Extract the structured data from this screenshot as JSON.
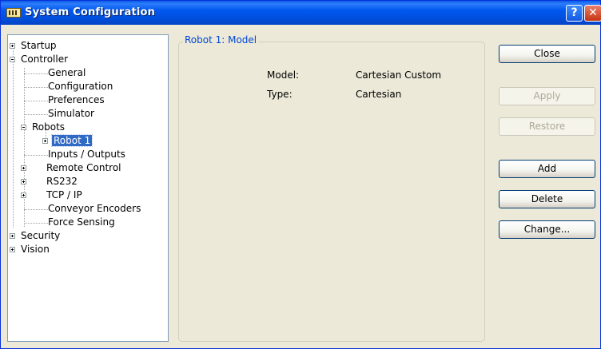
{
  "window": {
    "title": "System Configuration",
    "help_glyph": "?",
    "close_glyph": "✕"
  },
  "tree": {
    "items": [
      {
        "label": "Startup",
        "expander": "plus"
      },
      {
        "label": "Controller",
        "expander": "minus"
      },
      {
        "label": "General"
      },
      {
        "label": "Configuration"
      },
      {
        "label": "Preferences"
      },
      {
        "label": "Simulator"
      },
      {
        "label": "Robots",
        "expander": "minus"
      },
      {
        "label": "Robot 1",
        "expander": "plus",
        "selected": true
      },
      {
        "label": "Inputs / Outputs"
      },
      {
        "label": "Remote Control",
        "expander": "plus"
      },
      {
        "label": "RS232",
        "expander": "plus"
      },
      {
        "label": "TCP / IP",
        "expander": "plus"
      },
      {
        "label": "Conveyor Encoders"
      },
      {
        "label": "Force Sensing"
      },
      {
        "label": "Security",
        "expander": "plus"
      },
      {
        "label": "Vision",
        "expander": "plus"
      }
    ]
  },
  "details": {
    "group_title": "Robot 1: Model",
    "model_label": "Model:",
    "model_value": "Cartesian Custom",
    "type_label": "Type:",
    "type_value": "Cartesian"
  },
  "buttons": {
    "close": "Close",
    "apply": "Apply",
    "restore": "Restore",
    "add": "Add",
    "delete": "Delete",
    "change": "Change..."
  },
  "colors": {
    "title_blue": "#0058EE",
    "selection": "#316AC5",
    "group_title": "#0046D5"
  }
}
